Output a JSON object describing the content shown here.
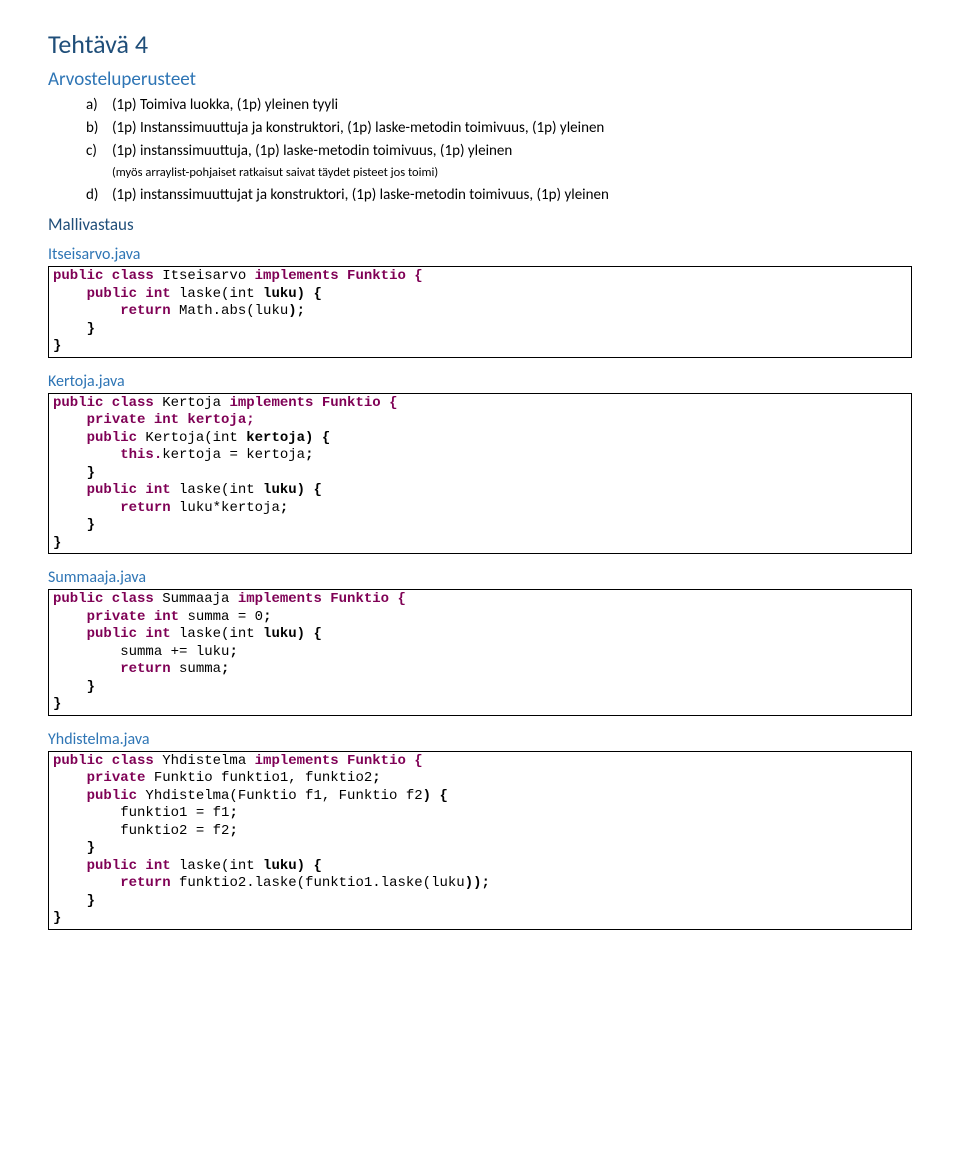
{
  "title": "Tehtävä 4",
  "sections": {
    "perusteet_heading": "Arvosteluperusteet",
    "items": [
      {
        "mk": "a)",
        "text": "(1p) Toimiva luokka, (1p) yleinen tyyli"
      },
      {
        "mk": "b)",
        "text": "(1p) Instanssimuuttuja ja konstruktori, (1p) laske-metodin toimivuus, (1p) yleinen"
      },
      {
        "mk": "c)",
        "text": "(1p) instanssimuuttuja, (1p) laske-metodin toimivuus, (1p) yleinen",
        "note": "(myös arraylist-pohjaiset ratkaisut saivat täydet pisteet jos toimi)"
      },
      {
        "mk": "d)",
        "text": "(1p) instanssimuuttujat ja konstruktori, (1p) laske-metodin toimivuus, (1p) yleinen"
      }
    ],
    "mallivastaus_heading": "Mallivastaus"
  },
  "files": {
    "itseisarvo": {
      "name": "Itseisarvo.java",
      "decl_pre": "public class ",
      "classname": "Itseisarvo ",
      "decl_post": "implements Funktio {",
      "m1_sig_pre": "public int ",
      "m1_sig_mid": "laske(int ",
      "m1_sig_post": "luku) {",
      "m1_body_pre": "return ",
      "m1_body_mid": "Math.abs(luku",
      "m1_body_post": ");"
    },
    "kertoja": {
      "name": "Kertoja.java",
      "decl_pre": "public class ",
      "classname": "Kertoja ",
      "decl_post": "implements Funktio {",
      "field": "private int kertoja;",
      "ctor_sig_pre": "public ",
      "ctor_sig_mid": "Kertoja(int ",
      "ctor_sig_post": "kertoja) {",
      "ctor_body_pre": "this.",
      "ctor_body_mid": "kertoja = kertoja",
      "ctor_body_post": ";",
      "m_sig_pre": "public int ",
      "m_sig_mid": "laske(int ",
      "m_sig_post": "luku) {",
      "m_body_pre": "return ",
      "m_body_mid": "luku*kertoja",
      "m_body_post": ";"
    },
    "summaaja": {
      "name": "Summaaja.java",
      "decl_pre": "public class ",
      "classname": "Summaaja ",
      "decl_post": "implements Funktio {",
      "field_pre": "private int ",
      "field_mid": "summa = ",
      "field_num": "0",
      "field_post": ";",
      "m_sig_pre": "public int ",
      "m_sig_mid": "laske(int ",
      "m_sig_post": "luku) {",
      "m_body1_mid": "summa += luku",
      "m_body1_post": ";",
      "m_body2_pre": "return ",
      "m_body2_mid": "summa",
      "m_body2_post": ";"
    },
    "yhdistelma": {
      "name": "Yhdistelma.java",
      "decl_pre": "public class ",
      "classname": "Yhdistelma ",
      "decl_post": "implements Funktio {",
      "field_pre": "private ",
      "field_mid": "Funktio funktio1, funktio2",
      "field_post": ";",
      "ctor_sig_pre": "public ",
      "ctor_sig_mid": "Yhdistelma(Funktio f1, Funktio f2",
      "ctor_sig_post": ") {",
      "ctor_b1_mid": "funktio1 = f1",
      "ctor_b1_post": ";",
      "ctor_b2_mid": "funktio2 = f2",
      "ctor_b2_post": ";",
      "m_sig_pre": "public int ",
      "m_sig_mid": "laske(int ",
      "m_sig_post": "luku) {",
      "m_body_pre": "return ",
      "m_body_mid": "funktio2.laske(funktio1.laske(luku",
      "m_body_post": "));"
    }
  },
  "braces": {
    "close": "}",
    "indent1_close": "    }"
  }
}
